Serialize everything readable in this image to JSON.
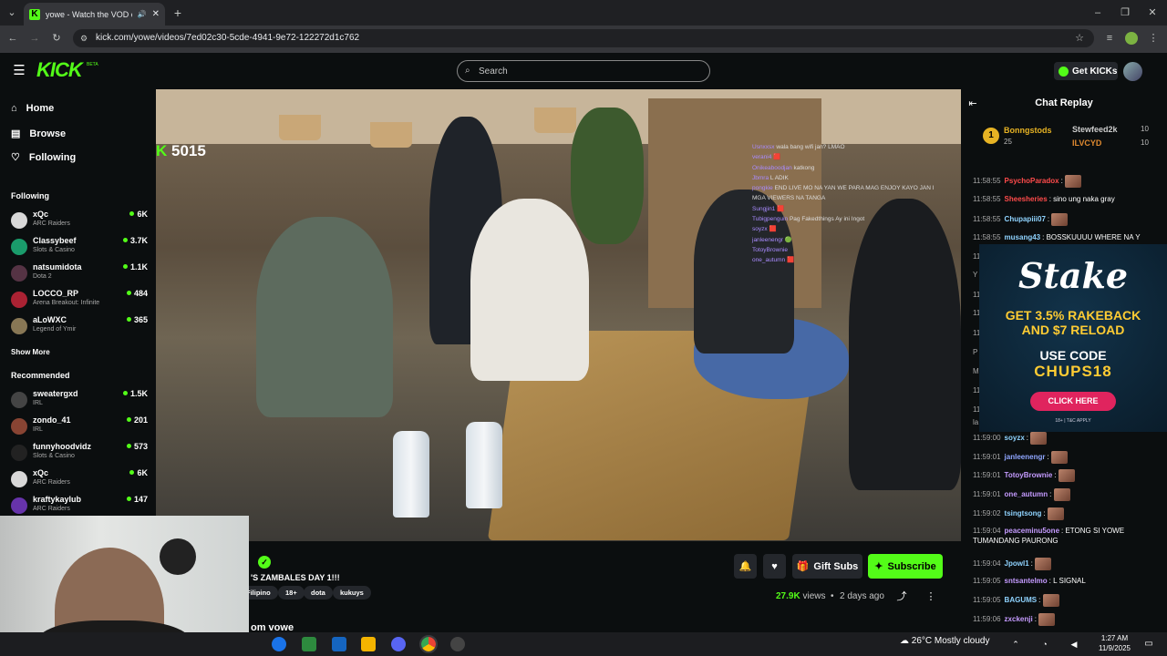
{
  "browser": {
    "tab_title": "yowe - Watch the VOD on Kick",
    "url": "kick.com/yowe/videos/7ed02c30-5cde-4941-9e72-122272d1c762"
  },
  "topnav": {
    "logo": "KICK",
    "beta": "BETA",
    "search_placeholder": "Search",
    "get_kicks": "Get KICKs"
  },
  "sidebar": {
    "nav": [
      {
        "label": "Home"
      },
      {
        "label": "Browse"
      },
      {
        "label": "Following"
      }
    ],
    "following_title": "Following",
    "following": [
      {
        "name": "xQc",
        "category": "ARC Raiders",
        "viewers": "6K",
        "color": "#d8d8d8"
      },
      {
        "name": "Classybeef",
        "category": "Slots & Casino",
        "viewers": "3.7K",
        "color": "#1a9b6b"
      },
      {
        "name": "natsumidota",
        "category": "Dota 2",
        "viewers": "1.1K",
        "color": "#553344"
      },
      {
        "name": "LOCCO_RP",
        "category": "Arena Breakout: Infinite",
        "viewers": "484",
        "color": "#aa2233"
      },
      {
        "name": "aLoWXC",
        "category": "Legend of Ymir",
        "viewers": "365",
        "color": "#887755"
      }
    ],
    "show_more": "Show More",
    "recommended_title": "Recommended",
    "recommended": [
      {
        "name": "sweatergxd",
        "category": "IRL",
        "viewers": "1.5K",
        "color": "#444"
      },
      {
        "name": "zondo_41",
        "category": "IRL",
        "viewers": "201",
        "color": "#884433"
      },
      {
        "name": "funnyhoodvidz",
        "category": "Slots & Casino",
        "viewers": "573",
        "color": "#222"
      },
      {
        "name": "xQc",
        "category": "ARC Raiders",
        "viewers": "6K",
        "color": "#d8d8d8"
      },
      {
        "name": "kraftykaylub",
        "category": "ARC Raiders",
        "viewers": "147",
        "color": "#6633aa"
      }
    ]
  },
  "video": {
    "sub_count": "5015",
    "overlay_chat": [
      {
        "user": "Usnxxsx",
        "text": "wala bang wifi jan? LMAO"
      },
      {
        "user": "verani4",
        "text": "🟥"
      },
      {
        "user": "Onikeaboodjan",
        "text": "katkong"
      },
      {
        "user": "Jbmra",
        "text": "L ADIK"
      },
      {
        "user": "pongkie",
        "text": "END LIVE MO NA YAN WE PARA MAG ENJOY KAYO JAN I"
      },
      {
        "user": "",
        "text": "MGA VIEWERS NA TANGA"
      },
      {
        "user": "Sungjin1",
        "text": "🟥"
      },
      {
        "user": "Tubigpenguin",
        "text": "Pag Fakedthings Ay ini Ingot"
      },
      {
        "user": "soyzx",
        "text": "🟥"
      },
      {
        "user": "janleenengr",
        "text": "🟢"
      },
      {
        "user": "TotoyBrownie",
        "text": ""
      },
      {
        "user": "one_autumn",
        "text": "🟥"
      }
    ]
  },
  "stream_info": {
    "title_fragment": "'S ZAMBALES DAY 1!!!",
    "channel_fragment": "e",
    "tags": [
      "Filipino",
      "18+",
      "dota",
      "kukuys"
    ],
    "views": "27.9K",
    "views_label": "views",
    "ago": "2 days ago",
    "gift_subs": "Gift Subs",
    "subscribe": "Subscribe",
    "more_from": "om vowe"
  },
  "chat": {
    "title": "Chat Replay",
    "leaderboard": {
      "first": {
        "name": "Bonngstods",
        "count": "25"
      },
      "second": {
        "name": "Stewfeed2k",
        "count": "10"
      },
      "third": {
        "name": "ILVCYD",
        "count": "10"
      }
    },
    "messages": [
      {
        "ts": "11:58:55",
        "user": "PsychoParadox",
        "text": ":",
        "color": "#ff4b4b"
      },
      {
        "ts": "11:58:55",
        "user": "Sheesheries",
        "text": ": sino ung naka gray",
        "color": "#ff4b4b"
      },
      {
        "ts": "11:58:55",
        "user": "Chupapiii07",
        "text": ":",
        "color": "#8fd3ff"
      },
      {
        "ts": "11:58:55",
        "user": "musang43",
        "text": ": BOSSKUUUU WHERE NA Y",
        "color": "#8fd3ff"
      },
      {
        "ts": "11:59:00",
        "user": "soyzx",
        "text": ":",
        "color": "#8fd3ff"
      },
      {
        "ts": "11:59:01",
        "user": "janleenengr",
        "text": ":",
        "color": "#8fa6ff"
      },
      {
        "ts": "11:59:01",
        "user": "TotoyBrownie",
        "text": ":",
        "color": "#c59bff"
      },
      {
        "ts": "11:59:01",
        "user": "one_autumn",
        "text": ":",
        "color": "#c59bff"
      },
      {
        "ts": "11:59:02",
        "user": "tsingtsong",
        "text": ":",
        "color": "#8fd3ff"
      },
      {
        "ts": "11:59:04",
        "user": "peaceminu5one",
        "text": ": ETONG SI YOWE TUMANDANG PAURONG",
        "color": "#c59bff"
      },
      {
        "ts": "11:59:04",
        "user": "Jpowl1",
        "text": ":",
        "color": "#8fd3ff"
      },
      {
        "ts": "11:59:05",
        "user": "sntsantelmo",
        "text": ": L SIGNAL",
        "color": "#c59bff"
      },
      {
        "ts": "11:59:05",
        "user": "BAGUMS",
        "text": ":",
        "color": "#8fd3ff"
      },
      {
        "ts": "11:59:06",
        "user": "zxckenji",
        "text": ":",
        "color": "#c59bff"
      }
    ],
    "hidden_partial": [
      "11",
      "Y",
      "11",
      "11",
      "11",
      "P",
      "M",
      "11",
      "11",
      "la"
    ]
  },
  "ad": {
    "brand": "Stake",
    "line1": "GET 3.5% RAKEBACK",
    "line2": "AND $7 RELOAD",
    "line3": "USE CODE",
    "code": "CHUPS18",
    "cta": "CLICK HERE",
    "terms": "18+ | T&C APPLY"
  },
  "taskbar": {
    "temp": "26°C",
    "weather": "Mostly cloudy",
    "time": "1:27 AM",
    "date": "11/9/2025"
  },
  "colors": {
    "accent": "#53fc18",
    "bg": "#0b0e0f",
    "surface": "#24272c"
  }
}
